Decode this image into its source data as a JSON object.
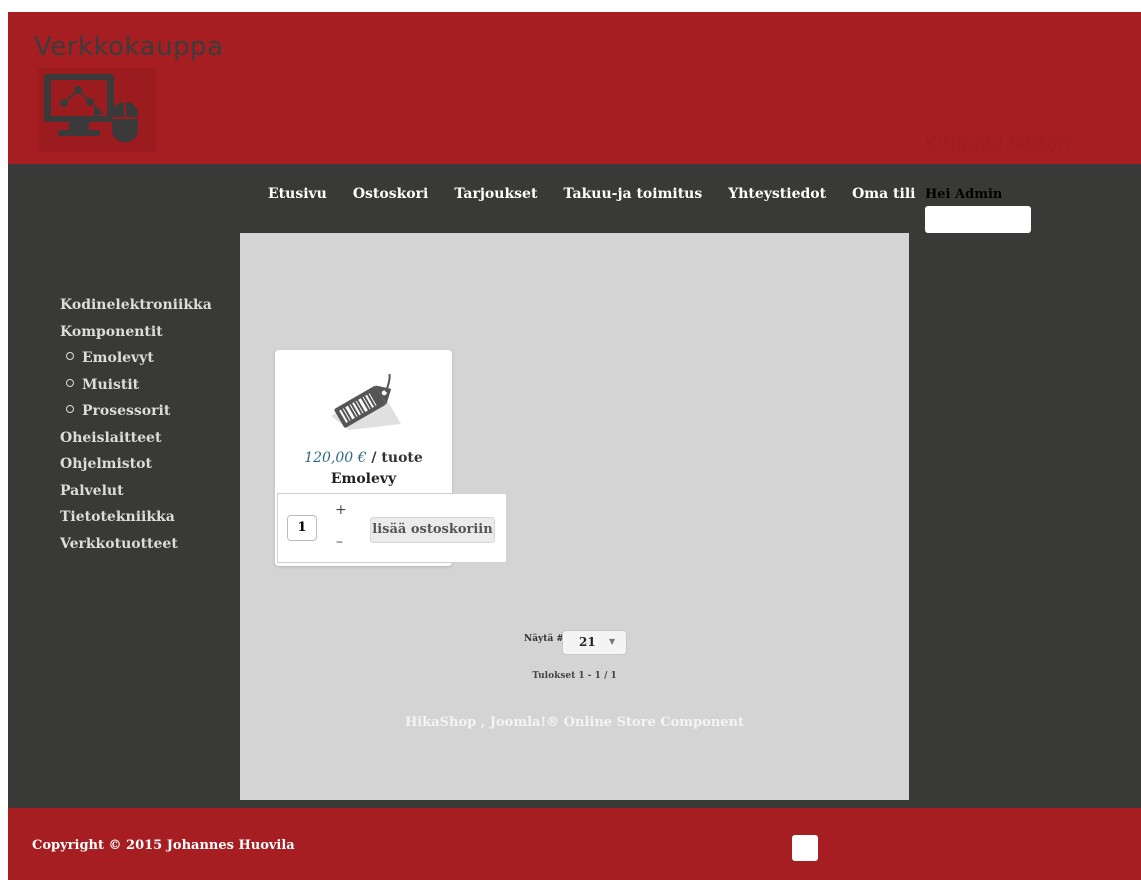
{
  "header": {
    "site_title": "Verkkokauppa",
    "logo_icon": "computer-mouse-network-logo"
  },
  "nav": {
    "items": [
      {
        "label": "Etusivu"
      },
      {
        "label": "Ostoskori"
      },
      {
        "label": "Tarjoukset"
      },
      {
        "label": "Takuu-ja toimitus"
      },
      {
        "label": "Yhteystiedot"
      },
      {
        "label": "Oma tili"
      }
    ]
  },
  "sidebar": {
    "items": [
      {
        "label": "Kodinelektroniikka"
      },
      {
        "label": "Komponentit"
      },
      {
        "label": "Emolevyt"
      },
      {
        "label": "Muistit"
      },
      {
        "label": "Prosessorit"
      },
      {
        "label": "Oheislaitteet"
      },
      {
        "label": "Ohjelmistot"
      },
      {
        "label": "Palvelut"
      },
      {
        "label": "Tietotekniikka"
      },
      {
        "label": "Verkkotuotteet"
      }
    ]
  },
  "product": {
    "image_icon": "price-tag-icon",
    "price": "120,00 €",
    "per_unit": " / tuote",
    "name": "Emolevy",
    "quantity": "1",
    "plus_label": "+",
    "minus_label": "–",
    "add_button_label": "lisää ostoskoriin"
  },
  "listing": {
    "limit_label": "Näytä #",
    "limit_value": "21",
    "results": "Tulokset 1 - 1 / 1",
    "powered_by": "HikaShop , Joomla!® Online Store Component"
  },
  "login": {
    "title": "Kirjaudu sisään",
    "greeting": "Hei Admin"
  },
  "footer": {
    "copyright": "Copyright © 2015 Johannes Huovila"
  },
  "colors": {
    "brand_red": "#a61e22",
    "dark_bg": "#393937",
    "content_bg": "#d4d4d4",
    "price_blue": "#2a6b88"
  }
}
